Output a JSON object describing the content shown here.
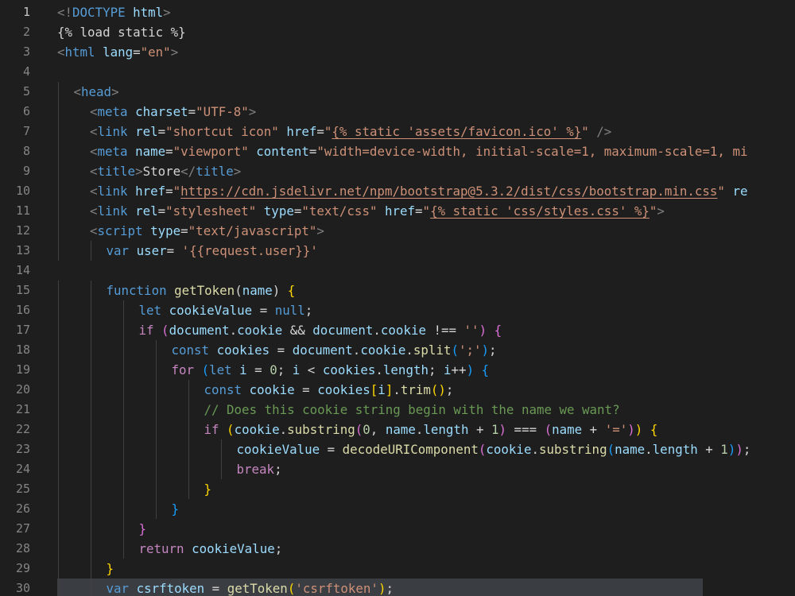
{
  "editor": {
    "colors": {
      "background": "#1e1e1e",
      "line_number": "#858585",
      "line_number_active": "#c6c6c6",
      "current_line_highlight": "#3a3d41",
      "tag_bracket": "#808080",
      "tag": "#569cd6",
      "attribute": "#9cdcfe",
      "string": "#ce9178",
      "keyword": "#569cd6",
      "control": "#c586c0",
      "function": "#dcdcaa",
      "variable": "#9cdcfe",
      "number": "#b5cea8",
      "comment": "#6a9955",
      "brace_gold": "#ffd700",
      "brace_purple": "#da70d6",
      "brace_blue": "#179fff",
      "plain": "#d4d4d4"
    },
    "active_line": 1,
    "highlighted_line": 30,
    "lines": [
      {
        "n": "1",
        "indent": 0,
        "tokens": [
          [
            "<!",
            "tb"
          ],
          [
            "DOCTYPE",
            "tg"
          ],
          [
            " html",
            "at"
          ],
          [
            ">",
            "tb"
          ]
        ]
      },
      {
        "n": "2",
        "indent": 0,
        "tokens": [
          [
            "{% load static %}",
            "pl"
          ]
        ]
      },
      {
        "n": "3",
        "indent": 0,
        "tokens": [
          [
            "<",
            "tb"
          ],
          [
            "html",
            "tg"
          ],
          [
            " ",
            "pl"
          ],
          [
            "lang",
            "at"
          ],
          [
            "=",
            "pl"
          ],
          [
            "\"en\"",
            "st"
          ],
          [
            ">",
            "tb"
          ]
        ]
      },
      {
        "n": "4",
        "indent": 0,
        "tokens": []
      },
      {
        "n": "5",
        "indent": 1,
        "tokens": [
          [
            "<",
            "tb"
          ],
          [
            "head",
            "tg"
          ],
          [
            ">",
            "tb"
          ]
        ]
      },
      {
        "n": "6",
        "indent": 2,
        "tokens": [
          [
            "<",
            "tb"
          ],
          [
            "meta",
            "tg"
          ],
          [
            " ",
            "pl"
          ],
          [
            "charset",
            "at"
          ],
          [
            "=",
            "pl"
          ],
          [
            "\"UTF-8\"",
            "st"
          ],
          [
            ">",
            "tb"
          ]
        ]
      },
      {
        "n": "7",
        "indent": 2,
        "tokens": [
          [
            "<",
            "tb"
          ],
          [
            "link",
            "tg"
          ],
          [
            " ",
            "pl"
          ],
          [
            "rel",
            "at"
          ],
          [
            "=",
            "pl"
          ],
          [
            "\"shortcut icon\"",
            "st"
          ],
          [
            " ",
            "pl"
          ],
          [
            "href",
            "at"
          ],
          [
            "=",
            "pl"
          ],
          [
            "\"",
            "st"
          ],
          [
            "{% static 'assets/favicon.ico' %}",
            "stu"
          ],
          [
            "\"",
            "st"
          ],
          [
            " ",
            "pl"
          ],
          [
            "/>",
            "tb"
          ]
        ]
      },
      {
        "n": "8",
        "indent": 2,
        "tokens": [
          [
            "<",
            "tb"
          ],
          [
            "meta",
            "tg"
          ],
          [
            " ",
            "pl"
          ],
          [
            "name",
            "at"
          ],
          [
            "=",
            "pl"
          ],
          [
            "\"viewport\"",
            "st"
          ],
          [
            " ",
            "pl"
          ],
          [
            "content",
            "at"
          ],
          [
            "=",
            "pl"
          ],
          [
            "\"width=device-width, initial-scale=1, maximum-scale=1, mi",
            "st"
          ]
        ]
      },
      {
        "n": "9",
        "indent": 2,
        "tokens": [
          [
            "<",
            "tb"
          ],
          [
            "title",
            "tg"
          ],
          [
            ">",
            "tb"
          ],
          [
            "Store",
            "pl"
          ],
          [
            "</",
            "tb"
          ],
          [
            "title",
            "tg"
          ],
          [
            ">",
            "tb"
          ]
        ]
      },
      {
        "n": "10",
        "indent": 2,
        "tokens": [
          [
            "<",
            "tb"
          ],
          [
            "link",
            "tg"
          ],
          [
            " ",
            "pl"
          ],
          [
            "href",
            "at"
          ],
          [
            "=",
            "pl"
          ],
          [
            "\"",
            "st"
          ],
          [
            "https://cdn.jsdelivr.net/npm/bootstrap@5.3.2/dist/css/bootstrap.min.css",
            "stu"
          ],
          [
            "\"",
            "st"
          ],
          [
            " ",
            "pl"
          ],
          [
            "re",
            "at"
          ]
        ]
      },
      {
        "n": "11",
        "indent": 2,
        "tokens": [
          [
            "<",
            "tb"
          ],
          [
            "link",
            "tg"
          ],
          [
            " ",
            "pl"
          ],
          [
            "rel",
            "at"
          ],
          [
            "=",
            "pl"
          ],
          [
            "\"stylesheet\"",
            "st"
          ],
          [
            " ",
            "pl"
          ],
          [
            "type",
            "at"
          ],
          [
            "=",
            "pl"
          ],
          [
            "\"text/css\"",
            "st"
          ],
          [
            " ",
            "pl"
          ],
          [
            "href",
            "at"
          ],
          [
            "=",
            "pl"
          ],
          [
            "\"",
            "st"
          ],
          [
            "{% static 'css/styles.css' %}",
            "stu"
          ],
          [
            "\"",
            "st"
          ],
          [
            ">",
            "tb"
          ]
        ]
      },
      {
        "n": "12",
        "indent": 2,
        "tokens": [
          [
            "<",
            "tb"
          ],
          [
            "script",
            "tg"
          ],
          [
            " ",
            "pl"
          ],
          [
            "type",
            "at"
          ],
          [
            "=",
            "pl"
          ],
          [
            "\"text/javascript\"",
            "st"
          ],
          [
            ">",
            "tb"
          ]
        ]
      },
      {
        "n": "13",
        "indent": 3,
        "tokens": [
          [
            "var",
            "kw"
          ],
          [
            " ",
            "pl"
          ],
          [
            "user",
            "va"
          ],
          [
            "= ",
            "pl"
          ],
          [
            "'{{request.user}}'",
            "st"
          ]
        ]
      },
      {
        "n": "14",
        "indent": 0,
        "tokens": []
      },
      {
        "n": "15",
        "indent": 3,
        "tokens": [
          [
            "function",
            "kw"
          ],
          [
            " ",
            "pl"
          ],
          [
            "getToken",
            "fn"
          ],
          [
            "(",
            "pl"
          ],
          [
            "name",
            "va"
          ],
          [
            ") ",
            "pl"
          ],
          [
            "{",
            "b1"
          ]
        ]
      },
      {
        "n": "16",
        "indent": 5,
        "tokens": [
          [
            "let",
            "kw"
          ],
          [
            " ",
            "pl"
          ],
          [
            "cookieValue",
            "va"
          ],
          [
            " = ",
            "pl"
          ],
          [
            "null",
            "kw"
          ],
          [
            ";",
            "pl"
          ]
        ]
      },
      {
        "n": "17",
        "indent": 5,
        "tokens": [
          [
            "if",
            "ct"
          ],
          [
            " ",
            "pl"
          ],
          [
            "(",
            "b2"
          ],
          [
            "document",
            "va"
          ],
          [
            ".",
            "pl"
          ],
          [
            "cookie",
            "va"
          ],
          [
            " && ",
            "pl"
          ],
          [
            "document",
            "va"
          ],
          [
            ".",
            "pl"
          ],
          [
            "cookie",
            "va"
          ],
          [
            " !== ",
            "pl"
          ],
          [
            "''",
            "st"
          ],
          [
            ") ",
            "b2"
          ],
          [
            "{",
            "b2"
          ]
        ]
      },
      {
        "n": "18",
        "indent": 7,
        "tokens": [
          [
            "const",
            "kw"
          ],
          [
            " ",
            "pl"
          ],
          [
            "cookies",
            "va"
          ],
          [
            " = ",
            "pl"
          ],
          [
            "document",
            "va"
          ],
          [
            ".",
            "pl"
          ],
          [
            "cookie",
            "va"
          ],
          [
            ".",
            "pl"
          ],
          [
            "split",
            "fn"
          ],
          [
            "(",
            "b3"
          ],
          [
            "';'",
            "st"
          ],
          [
            ")",
            "b3"
          ],
          [
            ";",
            "pl"
          ]
        ]
      },
      {
        "n": "19",
        "indent": 7,
        "tokens": [
          [
            "for",
            "ct"
          ],
          [
            " ",
            "pl"
          ],
          [
            "(",
            "b3"
          ],
          [
            "let",
            "kw"
          ],
          [
            " ",
            "pl"
          ],
          [
            "i",
            "va"
          ],
          [
            " = ",
            "pl"
          ],
          [
            "0",
            "nm"
          ],
          [
            "; ",
            "pl"
          ],
          [
            "i",
            "va"
          ],
          [
            " < ",
            "pl"
          ],
          [
            "cookies",
            "va"
          ],
          [
            ".",
            "pl"
          ],
          [
            "length",
            "va"
          ],
          [
            "; ",
            "pl"
          ],
          [
            "i",
            "va"
          ],
          [
            "++",
            "pl"
          ],
          [
            ") ",
            "b3"
          ],
          [
            "{",
            "b3"
          ]
        ]
      },
      {
        "n": "20",
        "indent": 9,
        "tokens": [
          [
            "const",
            "kw"
          ],
          [
            " ",
            "pl"
          ],
          [
            "cookie",
            "va"
          ],
          [
            " = ",
            "pl"
          ],
          [
            "cookies",
            "va"
          ],
          [
            "[",
            "b1"
          ],
          [
            "i",
            "va"
          ],
          [
            "]",
            "b1"
          ],
          [
            ".",
            "pl"
          ],
          [
            "trim",
            "fn"
          ],
          [
            "(",
            "b1"
          ],
          [
            ")",
            "b1"
          ],
          [
            ";",
            "pl"
          ]
        ]
      },
      {
        "n": "21",
        "indent": 9,
        "tokens": [
          [
            "// Does this cookie string begin with the name we want?",
            "cm"
          ]
        ]
      },
      {
        "n": "22",
        "indent": 9,
        "tokens": [
          [
            "if",
            "ct"
          ],
          [
            " ",
            "pl"
          ],
          [
            "(",
            "b1"
          ],
          [
            "cookie",
            "va"
          ],
          [
            ".",
            "pl"
          ],
          [
            "substring",
            "fn"
          ],
          [
            "(",
            "b2"
          ],
          [
            "0",
            "nm"
          ],
          [
            ", ",
            "pl"
          ],
          [
            "name",
            "va"
          ],
          [
            ".",
            "pl"
          ],
          [
            "length",
            "va"
          ],
          [
            " + ",
            "pl"
          ],
          [
            "1",
            "nm"
          ],
          [
            ")",
            "b2"
          ],
          [
            " === ",
            "pl"
          ],
          [
            "(",
            "b2"
          ],
          [
            "name",
            "va"
          ],
          [
            " + ",
            "pl"
          ],
          [
            "'='",
            "st"
          ],
          [
            ")",
            "b2"
          ],
          [
            ")",
            "b1"
          ],
          [
            " ",
            "pl"
          ],
          [
            "{",
            "b1"
          ]
        ]
      },
      {
        "n": "23",
        "indent": 11,
        "tokens": [
          [
            "cookieValue",
            "va"
          ],
          [
            " = ",
            "pl"
          ],
          [
            "decodeURIComponent",
            "fn"
          ],
          [
            "(",
            "b2"
          ],
          [
            "cookie",
            "va"
          ],
          [
            ".",
            "pl"
          ],
          [
            "substring",
            "fn"
          ],
          [
            "(",
            "b3"
          ],
          [
            "name",
            "va"
          ],
          [
            ".",
            "pl"
          ],
          [
            "length",
            "va"
          ],
          [
            " + ",
            "pl"
          ],
          [
            "1",
            "nm"
          ],
          [
            ")",
            "b3"
          ],
          [
            ")",
            "b2"
          ],
          [
            ";",
            "pl"
          ]
        ]
      },
      {
        "n": "24",
        "indent": 11,
        "tokens": [
          [
            "break",
            "ct"
          ],
          [
            ";",
            "pl"
          ]
        ]
      },
      {
        "n": "25",
        "indent": 9,
        "tokens": [
          [
            "}",
            "b1"
          ]
        ]
      },
      {
        "n": "26",
        "indent": 7,
        "tokens": [
          [
            "}",
            "b3"
          ]
        ]
      },
      {
        "n": "27",
        "indent": 5,
        "tokens": [
          [
            "}",
            "b2"
          ]
        ]
      },
      {
        "n": "28",
        "indent": 5,
        "tokens": [
          [
            "return",
            "ct"
          ],
          [
            " ",
            "pl"
          ],
          [
            "cookieValue",
            "va"
          ],
          [
            ";",
            "pl"
          ]
        ]
      },
      {
        "n": "29",
        "indent": 3,
        "tokens": [
          [
            "}",
            "b1"
          ]
        ]
      },
      {
        "n": "30",
        "indent": 3,
        "tokens": [
          [
            "var",
            "kw"
          ],
          [
            " ",
            "pl"
          ],
          [
            "csrftoken",
            "va"
          ],
          [
            " = ",
            "pl"
          ],
          [
            "getToken",
            "fn"
          ],
          [
            "(",
            "b1"
          ],
          [
            "'csrftoken'",
            "st"
          ],
          [
            ")",
            "b1"
          ],
          [
            ";",
            "pl"
          ]
        ]
      }
    ]
  }
}
